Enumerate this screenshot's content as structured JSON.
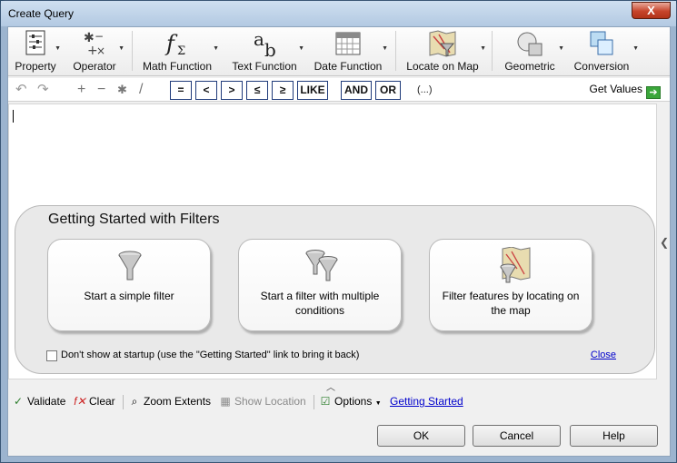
{
  "window": {
    "title": "Create Query",
    "close_glyph": "X"
  },
  "ribbon": {
    "buttons": [
      {
        "label": "Property",
        "icon": "property-list-icon"
      },
      {
        "label": "Operator",
        "icon": "operator-icon"
      },
      {
        "label": "Math Function",
        "icon": "math-function-icon"
      },
      {
        "label": "Text Function",
        "icon": "text-function-icon"
      },
      {
        "label": "Date Function",
        "icon": "calendar-icon"
      },
      {
        "label": "Locate on Map",
        "icon": "map-locate-icon"
      },
      {
        "label": "Geometric",
        "icon": "geometric-icon"
      },
      {
        "label": "Conversion",
        "icon": "conversion-icon"
      }
    ]
  },
  "operators": {
    "glyphs": [
      "+",
      "−",
      "✱",
      "/"
    ],
    "buttons": [
      "=",
      "<",
      ">",
      "≤",
      "≥",
      "LIKE",
      "AND",
      "OR"
    ],
    "paren": "(...)",
    "get_values": "Get Values"
  },
  "getting_started": {
    "title": "Getting Started with Filters",
    "cards": [
      "Start a simple filter",
      "Start a filter with multiple conditions",
      "Filter features by locating on the map"
    ],
    "checkbox_label": "Don't show at startup (use the \"Getting Started\" link to bring it back)",
    "close_link": "Close"
  },
  "bottom_toolbar": {
    "validate": "Validate",
    "clear": "Clear",
    "zoom_extents": "Zoom Extents",
    "show_location": "Show Location",
    "options": "Options",
    "getting_started": "Getting Started"
  },
  "dialog_buttons": {
    "ok": "OK",
    "cancel": "Cancel",
    "help": "Help"
  },
  "colors": {
    "accent": "#1f3a7a",
    "link": "#0000cc",
    "green": "#3aa63a"
  }
}
